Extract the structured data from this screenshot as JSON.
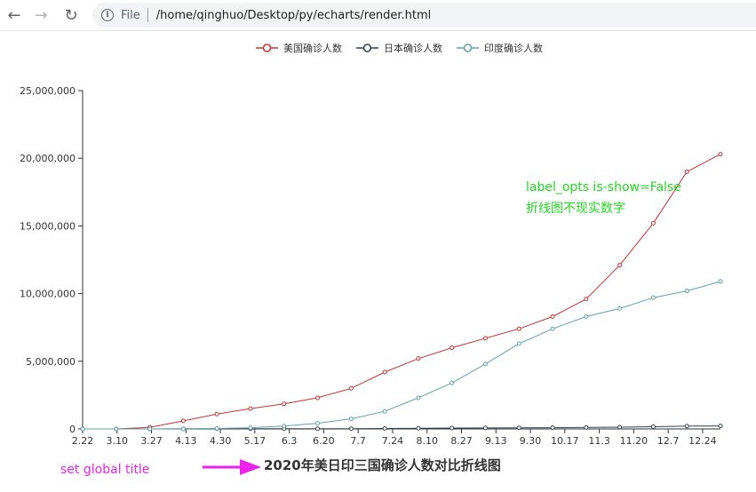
{
  "browser": {
    "back_icon": "←",
    "forward_icon": "→",
    "reload_icon": "↻",
    "info_icon": "i",
    "scheme": "File",
    "url": "/home/qinghuo/Desktop/py/echarts/render.html"
  },
  "annotations": {
    "note_line1": "label_opts is-show=False",
    "note_line2": "折线图不现实数字",
    "caption_left": "set global title",
    "arrow_color": "#ee22ee",
    "note_color": "#22d822"
  },
  "chart_data": {
    "type": "line",
    "title": "2020年美日印三国确诊人数对比折线图",
    "categories": [
      "2.22",
      "3.10",
      "3.27",
      "4.13",
      "4.30",
      "5.17",
      "6.3",
      "6.20",
      "7.7",
      "7.24",
      "8.10",
      "8.27",
      "9.13",
      "9.30",
      "10.17",
      "11.3",
      "11.20",
      "12.7",
      "12.24"
    ],
    "y_ticks": [
      "0",
      "5,000,000",
      "10,000,000",
      "15,000,000",
      "20,000,000",
      "25,000,000"
    ],
    "ylim": [
      0,
      25000000
    ],
    "legend_position": "top-center",
    "series": [
      {
        "name": "美国确诊人数",
        "color": "#c23531",
        "values": [
          0,
          1000,
          120000,
          600000,
          1100000,
          1500000,
          1850000,
          2300000,
          3000000,
          4200000,
          5200000,
          6000000,
          6700000,
          7400000,
          8300000,
          9600000,
          12100000,
          15200000,
          19000000,
          20300000
        ]
      },
      {
        "name": "日本确诊人数",
        "color": "#2f4554",
        "values": [
          0,
          500,
          1500,
          8000,
          14000,
          16500,
          17000,
          18000,
          20000,
          30000,
          50000,
          65000,
          75000,
          85000,
          95000,
          110000,
          130000,
          165000,
          210000,
          220000
        ]
      },
      {
        "name": "印度确诊人数",
        "color": "#61a0a8",
        "values": [
          0,
          100,
          700,
          12000,
          34000,
          90000,
          210000,
          420000,
          750000,
          1300000,
          2300000,
          3400000,
          4800000,
          6300000,
          7400000,
          8300000,
          8900000,
          9700000,
          10200000,
          10900000
        ]
      }
    ]
  }
}
